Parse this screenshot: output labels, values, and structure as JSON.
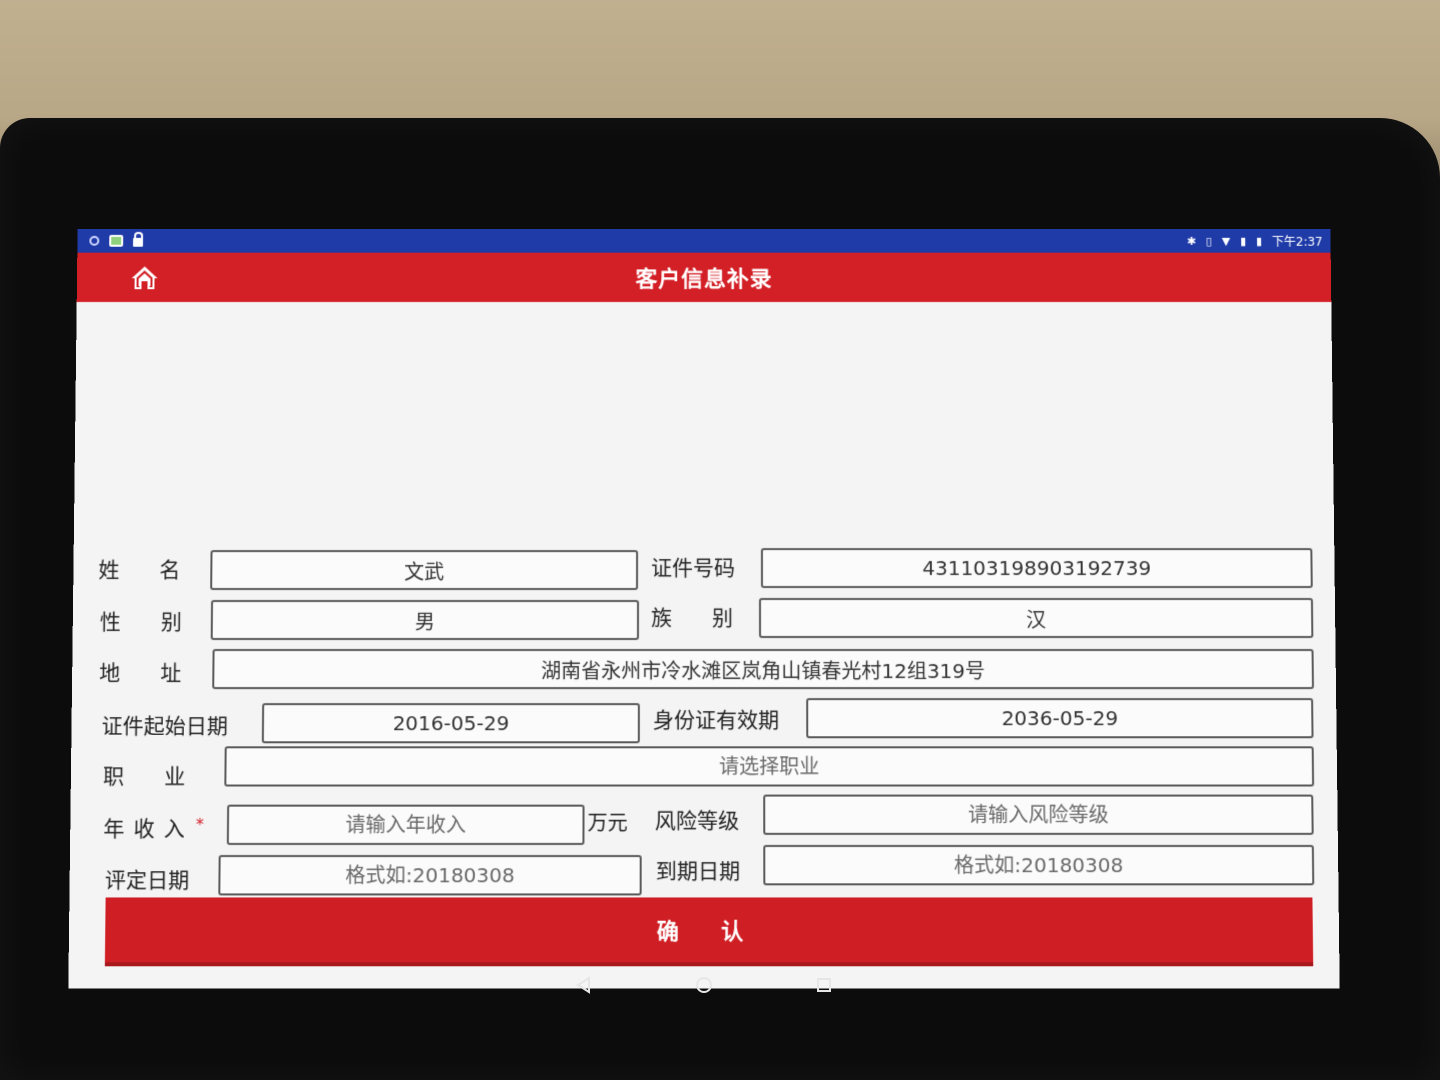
{
  "statusbar": {
    "time": "下午2:37",
    "left_icons": [
      "notification-dot-icon",
      "image-icon",
      "lock-icon"
    ],
    "right_icons": [
      "bluetooth-icon",
      "vibrate-icon",
      "wifi-icon",
      "signal-icon",
      "battery-icon"
    ],
    "color": "#1f3ba8"
  },
  "appbar": {
    "title": "客户信息补录",
    "home_icon": "home-icon",
    "color": "#d31f26"
  },
  "form": {
    "name": {
      "label": "姓名",
      "value": "文武"
    },
    "id_number": {
      "label": "证件号码",
      "value": "431103198903192739"
    },
    "gender": {
      "label": "性别",
      "value": "男"
    },
    "ethnicity": {
      "label": "族别",
      "value": "汉"
    },
    "address": {
      "label": "地址",
      "value": "湖南省永州市冷水滩区岚角山镇春光村12组319号"
    },
    "id_start_date": {
      "label": "证件起始日期",
      "value": "2016-05-29"
    },
    "id_valid_until": {
      "label": "身份证有效期",
      "value": "2036-05-29"
    },
    "occupation": {
      "label": "职业",
      "required_mark": "*",
      "placeholder": "请选择职业"
    },
    "annual_income": {
      "label": "年收入",
      "required_mark": "*",
      "placeholder": "请输入年收入",
      "unit": "万元"
    },
    "risk_level": {
      "label": "风险等级",
      "placeholder": "请输入风险等级"
    },
    "assessment_date": {
      "label": "评定日期",
      "placeholder": "格式如:20180308"
    },
    "expiry_date": {
      "label": "到期日期",
      "placeholder": "格式如:20180308"
    }
  },
  "actions": {
    "confirm_label": "确 认",
    "color": "#cf1e24"
  },
  "navigation": {
    "buttons": [
      "back-icon",
      "home-circle-icon",
      "recents-icon"
    ]
  }
}
